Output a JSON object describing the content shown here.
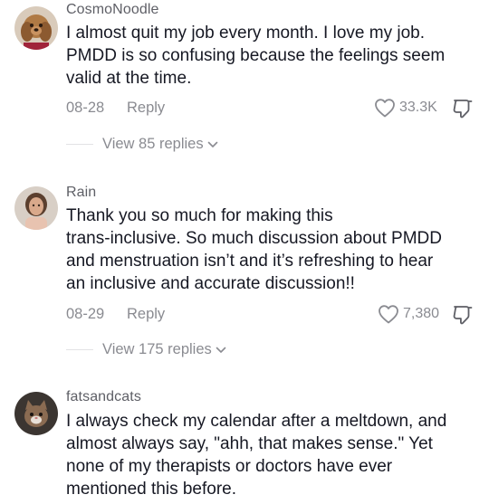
{
  "comments": [
    {
      "username": "CosmoNoodle",
      "avatar_icon": "dog-avatar-icon",
      "lines": [
        "I almost quit my job every month. I love my job.",
        "PMDD is so confusing because the feelings seem",
        "valid at the time."
      ],
      "date": "08-28",
      "reply_label": "Reply",
      "likes": "33.3K",
      "view_replies": "View 85 replies"
    },
    {
      "username": "Rain",
      "avatar_icon": "person-avatar-icon",
      "lines": [
        "Thank you so much for making this",
        "trans-inclusive. So much discussion about PMDD",
        "and menstruation isn’t and it’s refreshing to hear",
        "an inclusive and accurate discussion!!"
      ],
      "date": "08-29",
      "reply_label": "Reply",
      "likes": "7,380",
      "view_replies": "View 175 replies"
    },
    {
      "username": "fatsandcats",
      "avatar_icon": "cat-avatar-icon",
      "lines": [
        "I always check my calendar after a meltdown, and",
        "almost always say, \"ahh, that makes sense.\" Yet",
        "none of my therapists or doctors have ever",
        "mentioned this before."
      ]
    }
  ],
  "colors": {
    "text": "#161823",
    "muted": "#8a8b91",
    "username": "#5e5f66"
  }
}
